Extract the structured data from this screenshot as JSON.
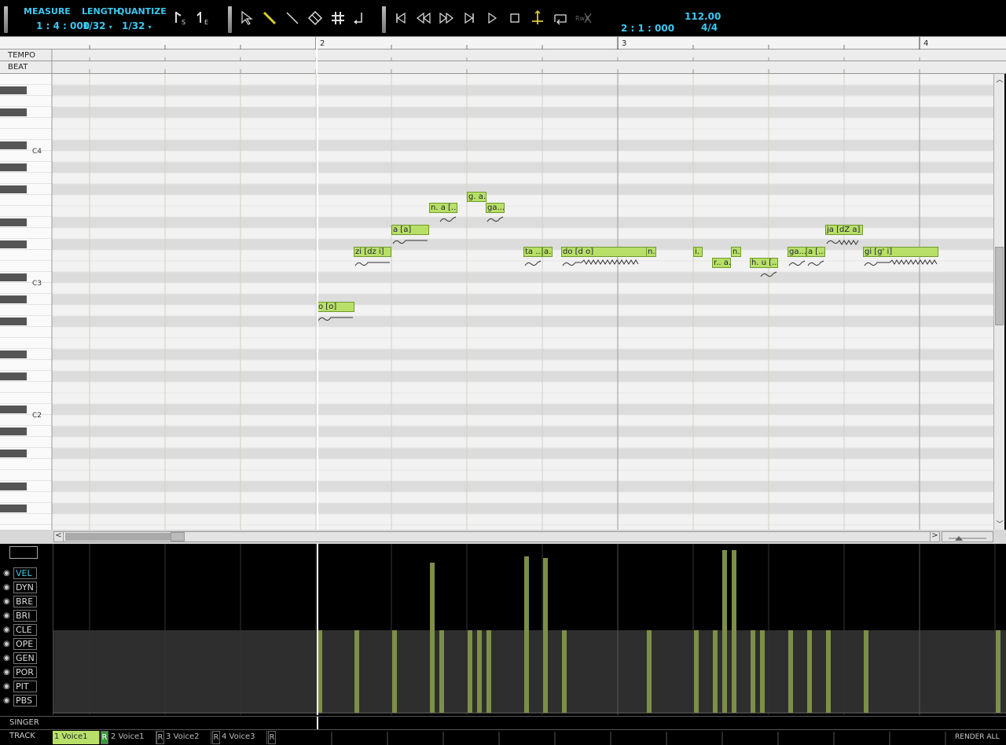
{
  "toolbar": {
    "measure_label": "MEASURE",
    "measure_value": "1 : 4 : 000",
    "length_label": "LENGTH",
    "length_value": "1/32",
    "quantize_label": "QUANTIZE",
    "quantize_value": "1/32",
    "position_value": "2 : 1 : 000",
    "tempo_value": "112.00",
    "time_sig_value": "4/4",
    "rwx_label": "RwX"
  },
  "ruler": {
    "tempo_label": "TEMPO",
    "beat_label": "BEAT",
    "measures": [
      "2",
      "3",
      "4"
    ]
  },
  "piano": {
    "octave_labels": [
      "C4",
      "C3",
      "C2"
    ]
  },
  "notes": [
    {
      "lyric": "o [o]"
    },
    {
      "lyric": "zi [dz i]"
    },
    {
      "lyric": "a [a]"
    },
    {
      "lyric": "n. a [..."
    },
    {
      "lyric": "g. a."
    },
    {
      "lyric": "ga..."
    },
    {
      "lyric": "ta ..."
    },
    {
      "lyric": "a."
    },
    {
      "lyric": "do [d o]"
    },
    {
      "lyric": "n."
    },
    {
      "lyric": "i."
    },
    {
      "lyric": "r.. a."
    },
    {
      "lyric": "n."
    },
    {
      "lyric": "h. u [..."
    },
    {
      "lyric": "ga..."
    },
    {
      "lyric": "a [..."
    },
    {
      "lyric": "ja [dZ a]"
    },
    {
      "lyric": "gi [g' i]"
    }
  ],
  "params": [
    {
      "label": "VEL",
      "selected": true
    },
    {
      "label": "DYN"
    },
    {
      "label": "BRE"
    },
    {
      "label": "BRI"
    },
    {
      "label": "CLE"
    },
    {
      "label": "OPE"
    },
    {
      "label": "GEN"
    },
    {
      "label": "POR"
    },
    {
      "label": "PIT"
    },
    {
      "label": "PBS"
    }
  ],
  "singer_label": "SINGER",
  "track_label": "TRACK",
  "tracks": [
    {
      "name": "1 Voice1",
      "active": true
    },
    {
      "name": "2 Voice1"
    },
    {
      "name": "3 Voice2"
    },
    {
      "name": "4 Voice3"
    }
  ],
  "track_flag": "R",
  "render_all_label": "RENDER ALL",
  "colors": {
    "accent": "#3cc8f0",
    "note_fill": "#b8e068",
    "velocity_bar": "#7d8f47"
  }
}
